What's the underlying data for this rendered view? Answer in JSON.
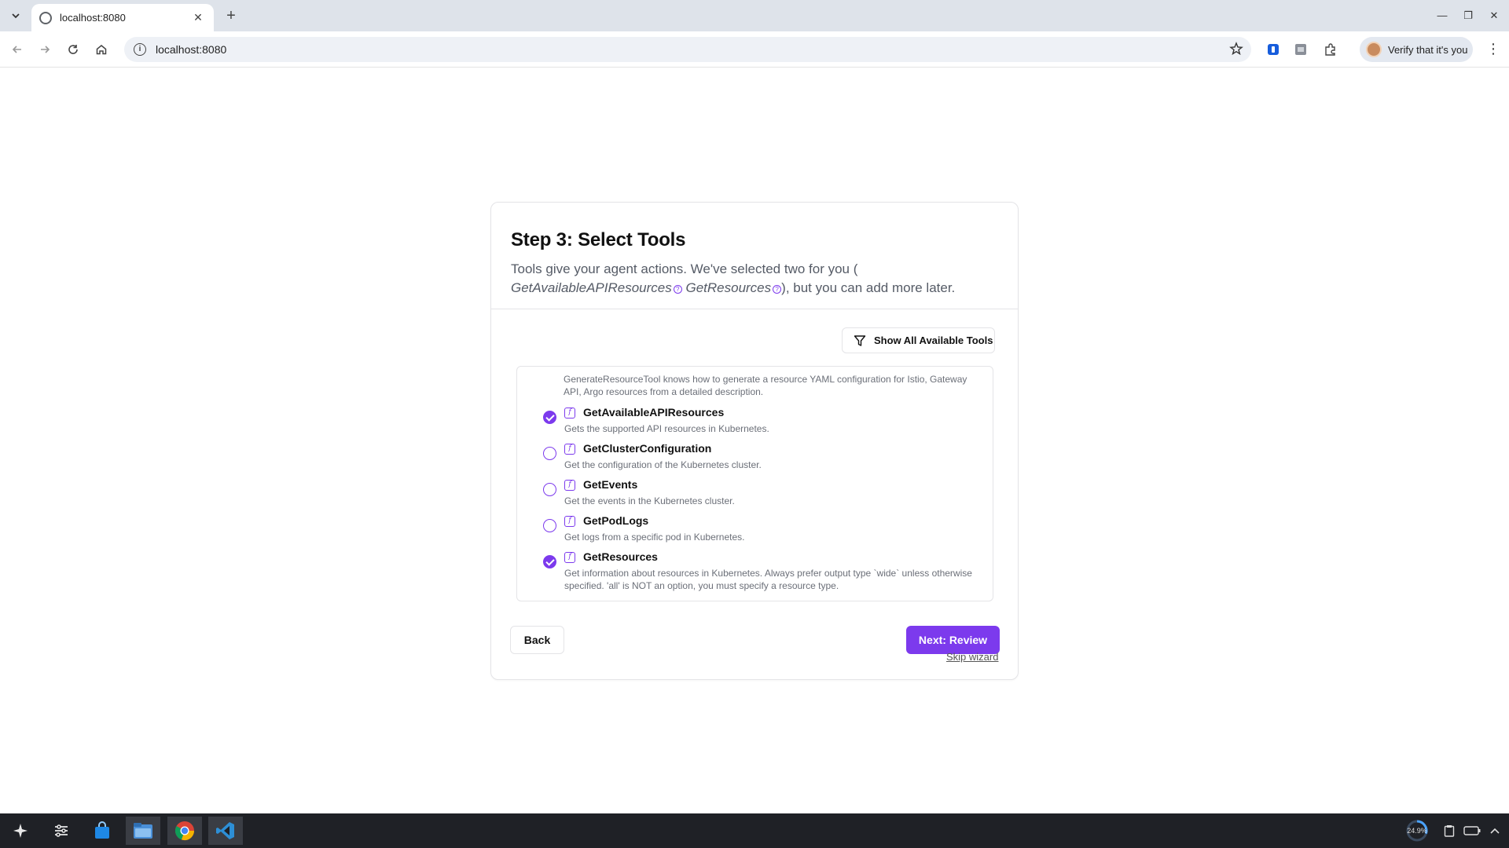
{
  "browser": {
    "tab_title": "localhost:8080",
    "url": "localhost:8080",
    "profile_label": "Verify that it's you"
  },
  "page": {
    "title": "Step 3: Select Tools",
    "description_prefix": "Tools give your agent actions. We've selected two for you (",
    "selected_tool_1": "GetAvailableAPIResources",
    "selected_tool_2": "GetResources",
    "description_suffix": "), but you can add more later.",
    "filter_button": "Show All Available Tools",
    "partial_tool_description": "GenerateResourceTool knows how to generate a resource YAML configuration for Istio, Gateway API, Argo resources from a detailed description.",
    "tools": [
      {
        "name": "GetAvailableAPIResources",
        "description": "Gets the supported API resources in Kubernetes.",
        "selected": true
      },
      {
        "name": "GetClusterConfiguration",
        "description": "Get the configuration of the Kubernetes cluster.",
        "selected": false
      },
      {
        "name": "GetEvents",
        "description": "Get the events in the Kubernetes cluster.",
        "selected": false
      },
      {
        "name": "GetPodLogs",
        "description": "Get logs from a specific pod in Kubernetes.",
        "selected": false
      },
      {
        "name": "GetResources",
        "description": "Get information about resources in Kubernetes. Always prefer output type `wide` unless otherwise specified. 'all' is NOT an option, you must specify a resource type.",
        "selected": true
      }
    ],
    "back_button": "Back",
    "next_button": "Next: Review",
    "skip_link": "Skip wizard"
  },
  "taskbar": {
    "cpu_label": "24.9%"
  },
  "colors": {
    "accent": "#7c3aed",
    "border": "#e4e4e7",
    "muted_text": "#6b6f78"
  }
}
